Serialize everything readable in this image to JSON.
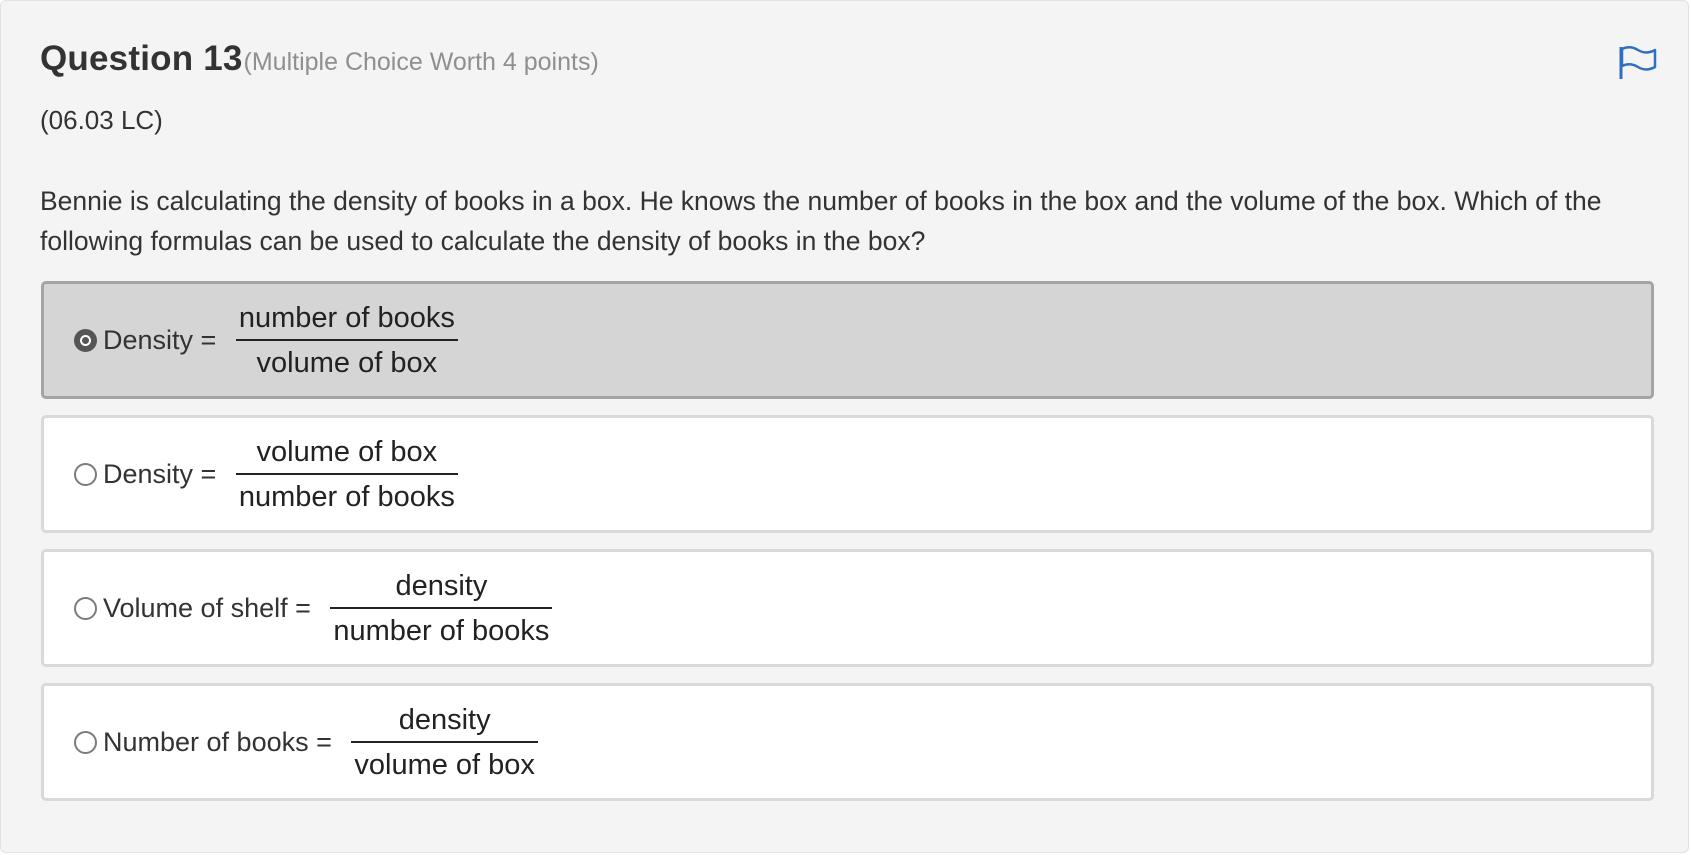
{
  "question": {
    "title": "Question 13",
    "meta": "(Multiple Choice Worth 4 points)",
    "code": "(06.03 LC)",
    "text": "Bennie is calculating the density of books in a box. He knows the number of books in the box and the volume of the box. Which of the following formulas can be used to calculate the density of books in the box?",
    "flag_icon": "flag-icon"
  },
  "options": [
    {
      "label": "Density = ",
      "numerator": "number of books",
      "denominator": "volume of box",
      "selected": true
    },
    {
      "label": "Density = ",
      "numerator": "volume of box",
      "denominator": "number of books",
      "selected": false
    },
    {
      "label": "Volume of shelf = ",
      "numerator": "density",
      "denominator": "number of books",
      "selected": false
    },
    {
      "label": "Number of books = ",
      "numerator": "density",
      "denominator": "volume of box",
      "selected": false
    }
  ],
  "colors": {
    "flag": "#2f6fc2",
    "selected_bg": "#d5d5d5",
    "panel_bg": "#f4f4f4"
  }
}
